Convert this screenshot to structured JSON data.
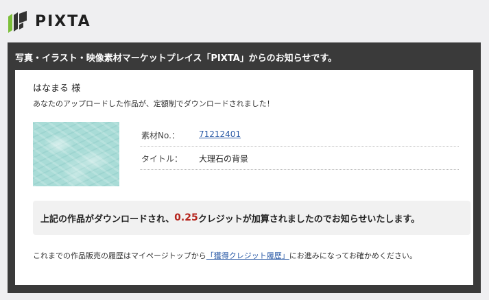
{
  "brand": {
    "name": "PIXTA",
    "colors": {
      "mark_green": "#7cbf3a",
      "mark_dark": "#333333"
    }
  },
  "mail": {
    "header": "写真・イラスト・映像素材マーケットプレイス「PIXTA」からのお知らせです。",
    "greeting": "はなまる 様",
    "intro": "あなたのアップロードした作品が、定額制でダウンロードされました！",
    "item": {
      "number_label": "素材No.：",
      "number": "71212401",
      "title_label": "タイトル：",
      "title": "大理石の背景"
    },
    "notice": {
      "before": "上記の作品がダウンロードされ、",
      "credit": "0.25",
      "after": "クレジットが加算されましたのでお知らせいたします。"
    },
    "footer": {
      "before": "これまでの作品販売の履歴はマイページトップから",
      "link": "「獲得クレジット履歴」",
      "after": "にお進みになってお確かめください。"
    },
    "colors": {
      "link": "#2a5aa6",
      "credit": "#b5241c",
      "header_bg": "#3a3a3a"
    }
  }
}
